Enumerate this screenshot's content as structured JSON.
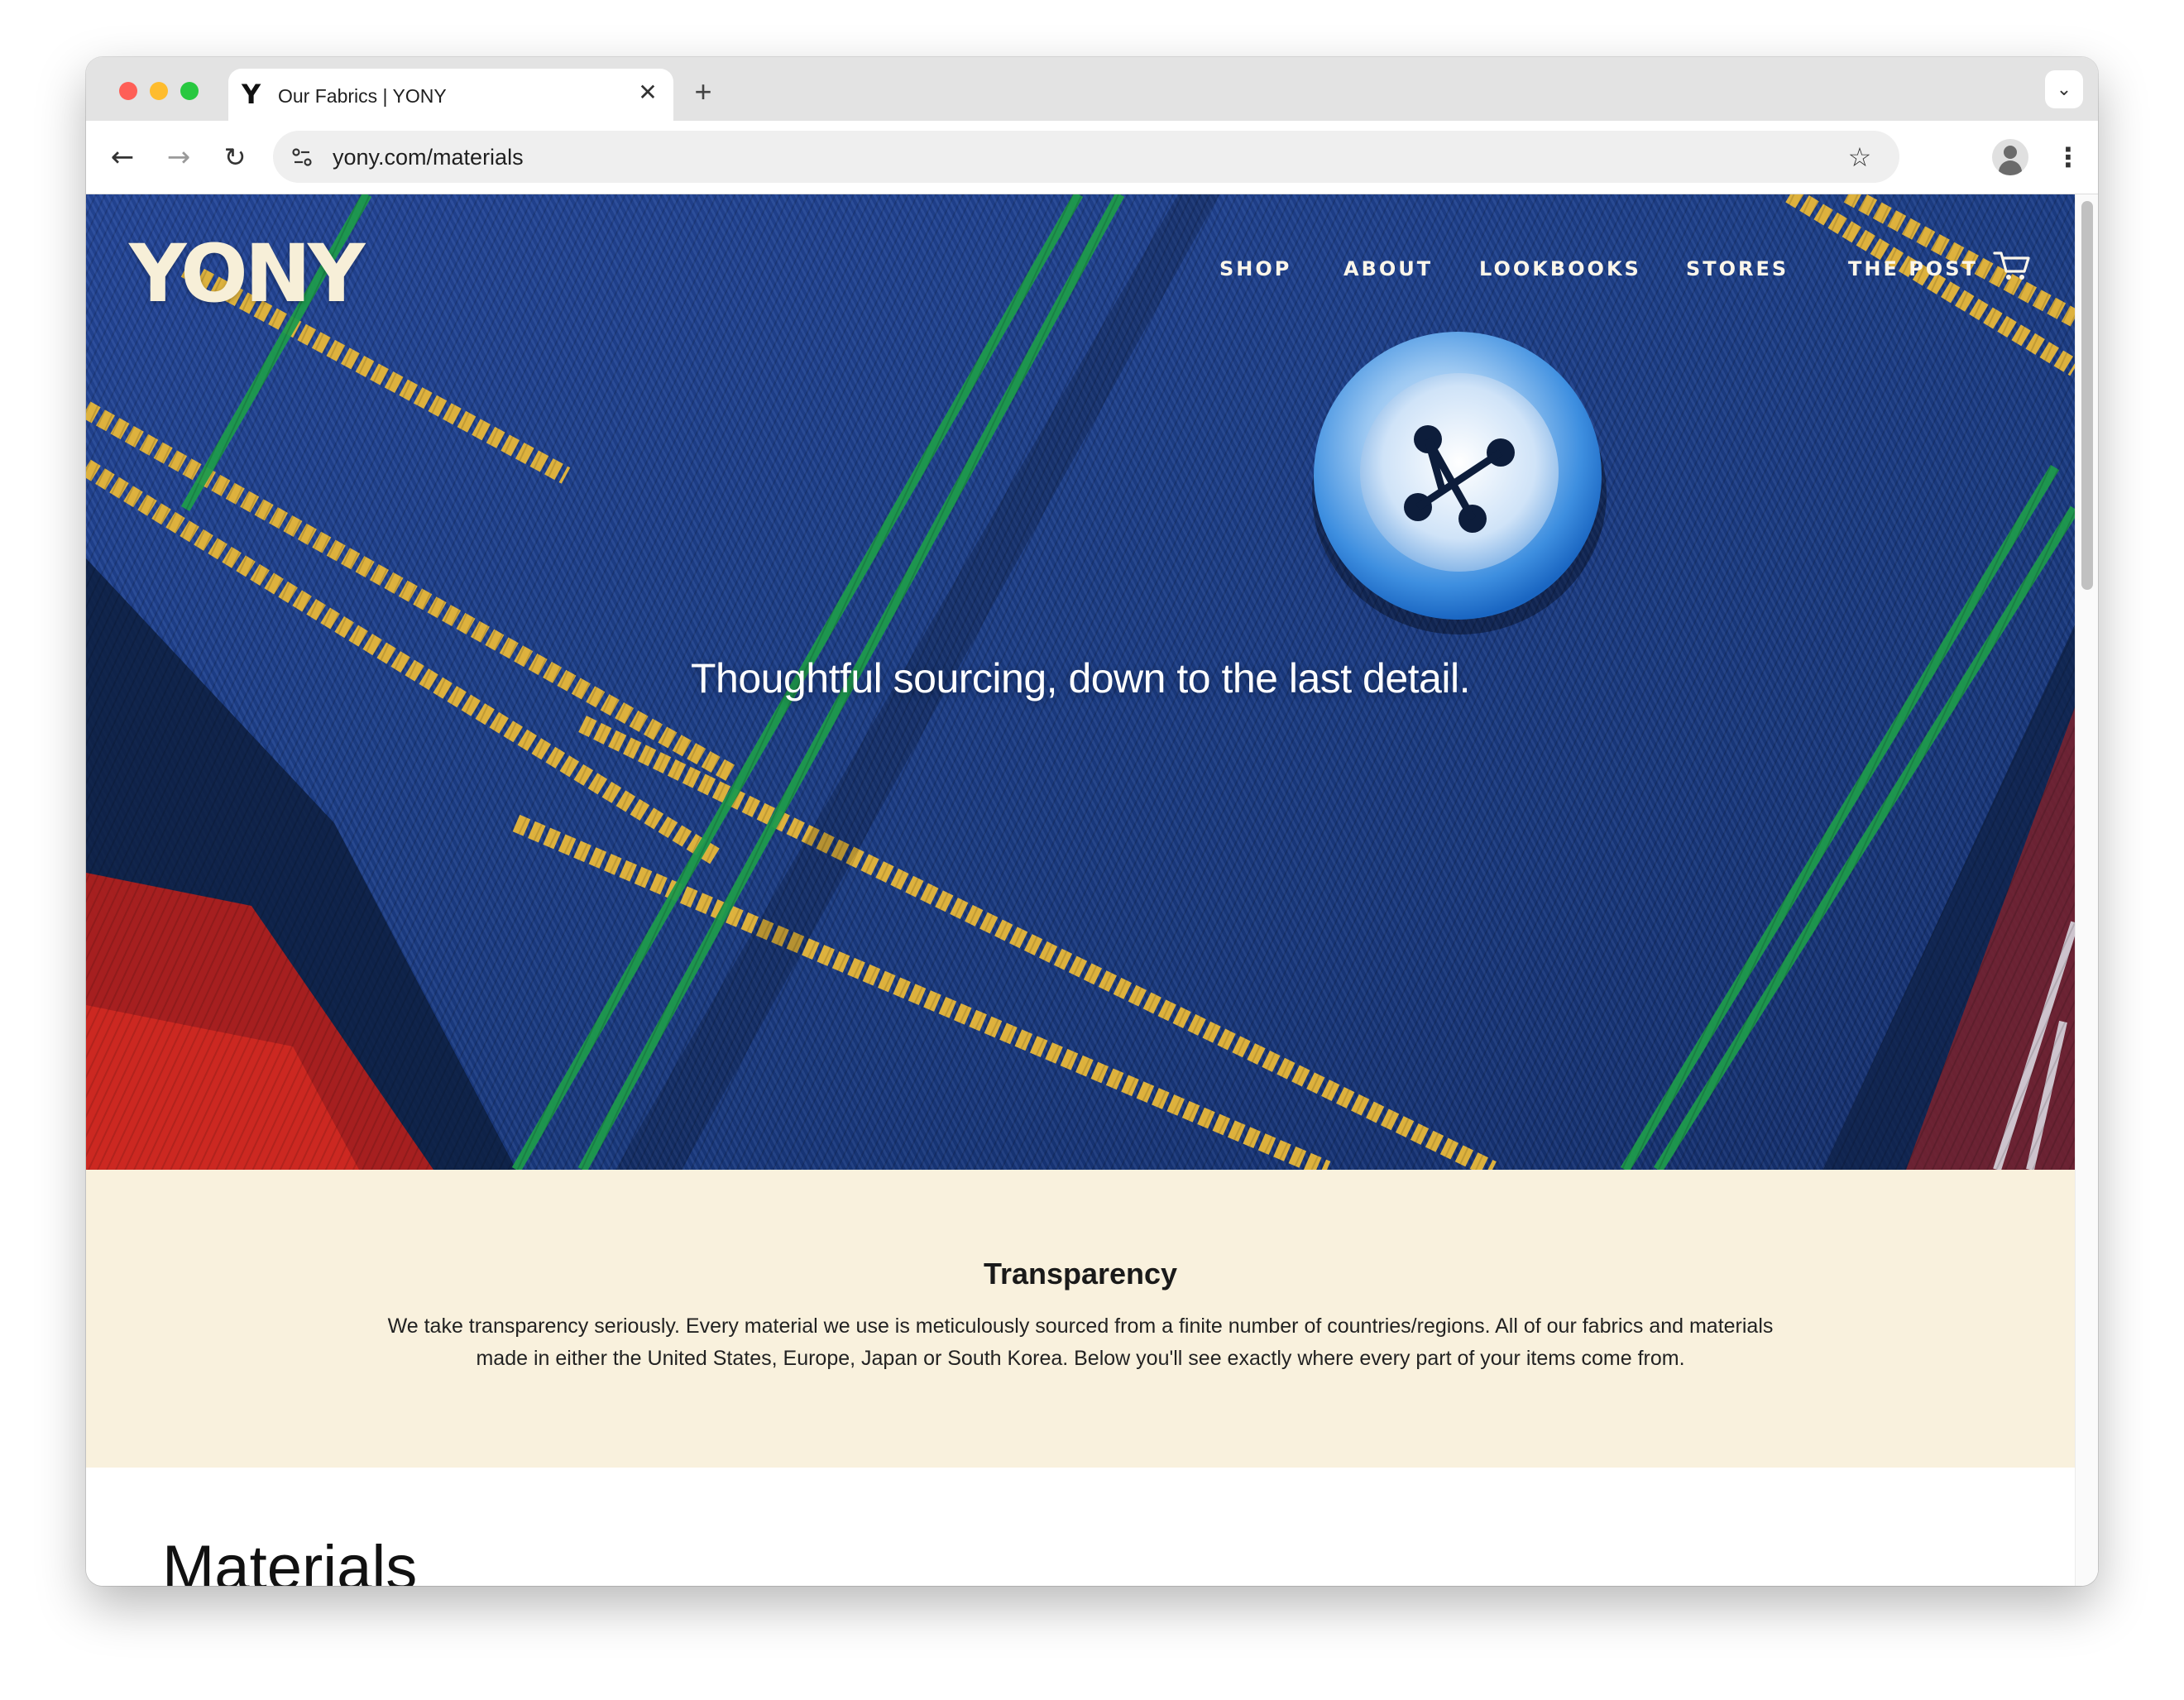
{
  "browser": {
    "tab_title": "Our Fabrics | YONY",
    "tab_favicon": "Y",
    "url": "yony.com/materials",
    "icons": {
      "close": "close-icon",
      "new_tab": "plus-icon",
      "tab_search": "chevron-down-icon",
      "back": "arrow-left-icon",
      "forward": "arrow-right-icon",
      "reload": "reload-icon",
      "site_info": "tune-icon",
      "bookmark": "star-icon",
      "profile": "person-icon",
      "menu": "kebab-menu-icon"
    }
  },
  "site": {
    "logo": "YONY",
    "nav": [
      "SHOP",
      "ABOUT",
      "LOOKBOOKS",
      "STORES",
      "THE POST"
    ],
    "cart_icon": "cart-icon"
  },
  "hero": {
    "tagline": "Thoughtful sourcing, down to the last detail."
  },
  "transparency": {
    "heading": "Transparency",
    "body": "We take transparency seriously. Every material we use is meticulously sourced from a finite number of countries/regions. All of our fabrics and materials made in either the United States, Europe, Japan or South Korea. Below you'll see exactly where every part of your items come from."
  },
  "materials": {
    "heading": "Materials"
  },
  "colors": {
    "hero_blue": "#1d3f8a",
    "cream": "#f9f1dd",
    "logo_cream": "#f7efd8",
    "tartan_yellow": "#e8b83a",
    "tartan_green": "#1e9a4c",
    "tartan_red": "#c8231f"
  }
}
